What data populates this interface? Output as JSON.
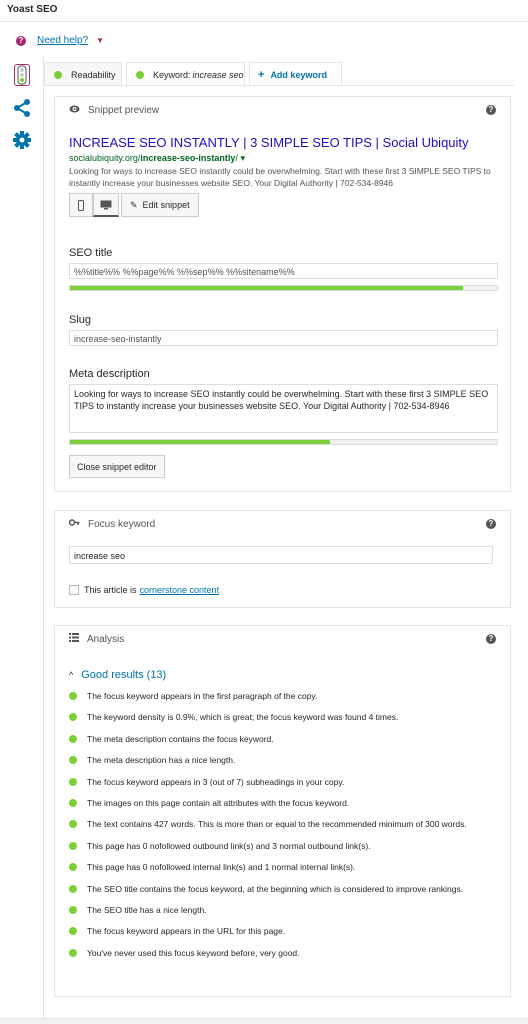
{
  "app": {
    "title": "Yoast SEO"
  },
  "help": {
    "label": "Need help?"
  },
  "sidebar": {
    "items": [
      "traffic-light-icon",
      "share-icon",
      "gear-icon"
    ]
  },
  "tabs": [
    {
      "label": "Readability"
    },
    {
      "label_prefix": "Keyword: ",
      "label_value": "increase seo"
    },
    {
      "label": "Add keyword"
    }
  ],
  "snippet": {
    "heading": "Snippet preview",
    "title": "INCREASE SEO INSTANTLY | 3 SIMPLE SEO TIPS | Social Ubiquity",
    "url_base": "socialubiquity.org/",
    "url_slug": "increase-seo-instantly",
    "url_tail": "/",
    "description": "Looking for ways to increase SEO instantly could be overwhelming. Start with these first 3 SIMPLE SEO TIPS to instantly increase your businesses website SEO. Your Digital Authority | 702-534-8946",
    "edit_label": "Edit snippet",
    "seo_title_label": "SEO title",
    "seo_title_value": "%%title%% %%page%% %%sep%% %%sitename%%",
    "seo_title_progress": 0.92,
    "slug_label": "Slug",
    "slug_value": "increase-seo-instantly",
    "meta_label": "Meta description",
    "meta_value": "Looking for ways to increase SEO instantly could be overwhelming. Start with these first 3 SIMPLE SEO TIPS to instantly increase your businesses website SEO. Your Digital Authority | 702-534-8946",
    "meta_progress": 0.61,
    "close_label": "Close snippet editor"
  },
  "focus": {
    "heading": "Focus keyword",
    "value": "increase seo",
    "cornerstone_prefix": "This article is",
    "cornerstone_link": "cornerstone content"
  },
  "analysis": {
    "heading": "Analysis",
    "good_label": "Good results (13)",
    "results": [
      "The focus keyword appears in the first paragraph of the copy.",
      "The keyword density is 0.9%, which is great; the focus keyword was found 4 times.",
      "The meta description contains the focus keyword.",
      "The meta description has a nice length.",
      "The focus keyword appears in 3 (out of 7) subheadings in your copy.",
      "The images on this page contain alt attributes with the focus keyword.",
      "The text contains 427 words. This is more than or equal to the recommended minimum of 300 words.",
      "This page has 0 nofollowed outbound link(s) and 3 normal outbound link(s).",
      "This page has 0 nofollowed internal link(s) and 1 normal internal link(s).",
      "The SEO title contains the focus keyword, at the beginning which is considered to improve rankings.",
      "The SEO title has a nice length.",
      "The focus keyword appears in the URL for this page.",
      "You've never used this focus keyword before, very good."
    ]
  },
  "colors": {
    "good": "#7ad03a",
    "link": "#0073aa",
    "brand": "#a4286a",
    "snippet_title": "#1e0fbe",
    "snippet_url": "#006621"
  }
}
